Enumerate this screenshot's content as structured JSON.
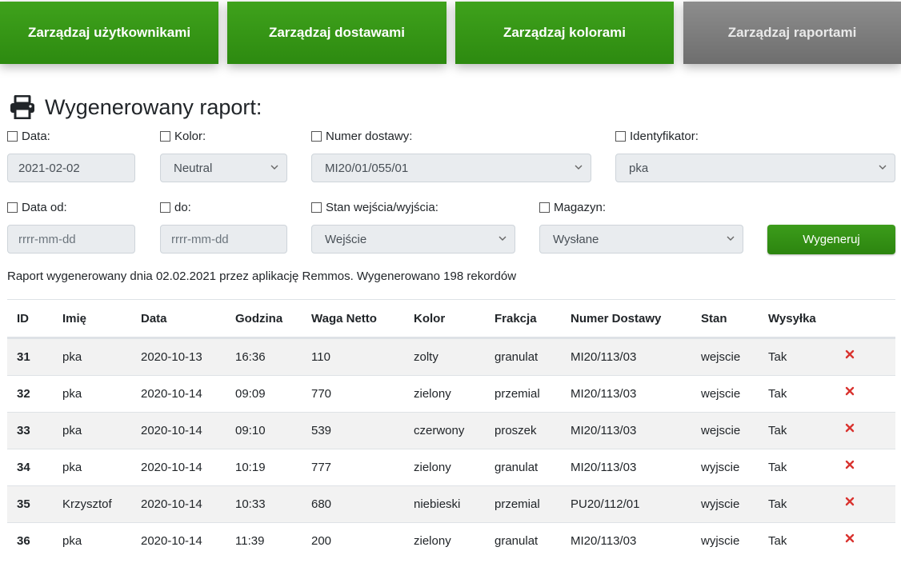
{
  "nav": {
    "users": "Zarządzaj użytkownikami",
    "deliveries": "Zarządzaj dostawami",
    "colors": "Zarządzaj kolorami",
    "reports": "Zarządzaj raportami"
  },
  "page": {
    "title": "Wygenerowany raport:",
    "title_icon": "printer-icon"
  },
  "filters": {
    "date": {
      "label": "Data:",
      "value": "2021-02-02"
    },
    "color": {
      "label": "Kolor:",
      "value": "Neutral"
    },
    "delivery_number": {
      "label": "Numer dostawy:",
      "value": "MI20/01/055/01"
    },
    "identifier": {
      "label": "Identyfikator:",
      "value": "pka"
    },
    "date_from": {
      "label": "Data od:",
      "placeholder": "rrrr-mm-dd"
    },
    "date_to": {
      "label": "do:",
      "placeholder": "rrrr-mm-dd"
    },
    "state": {
      "label": "Stan wejścia/wyjścia:",
      "value": "Wejście"
    },
    "warehouse": {
      "label": "Magazyn:",
      "value": "Wysłane"
    },
    "generate_label": "Wygeneruj"
  },
  "report_info": "Raport wygenerowany dnia 02.02.2021 przez aplikację Remmos. Wygenerowano 198 rekordów",
  "table": {
    "headers": [
      "ID",
      "Imię",
      "Data",
      "Godzina",
      "Waga Netto",
      "Kolor",
      "Frakcja",
      "Numer Dostawy",
      "Stan",
      "Wysyłka"
    ],
    "rows": [
      [
        "31",
        "pka",
        "2020-10-13",
        "16:36",
        "110",
        "zolty",
        "granulat",
        "MI20/113/03",
        "wejscie",
        "Tak"
      ],
      [
        "32",
        "pka",
        "2020-10-14",
        "09:09",
        "770",
        "zielony",
        "przemial",
        "MI20/113/03",
        "wejscie",
        "Tak"
      ],
      [
        "33",
        "pka",
        "2020-10-14",
        "09:10",
        "539",
        "czerwony",
        "proszek",
        "MI20/113/03",
        "wejscie",
        "Tak"
      ],
      [
        "34",
        "pka",
        "2020-10-14",
        "10:19",
        "777",
        "zielony",
        "granulat",
        "MI20/113/03",
        "wyjscie",
        "Tak"
      ],
      [
        "35",
        "Krzysztof",
        "2020-10-14",
        "10:33",
        "680",
        "niebieski",
        "przemial",
        "PU20/112/01",
        "wyjscie",
        "Tak"
      ],
      [
        "36",
        "pka",
        "2020-10-14",
        "11:39",
        "200",
        "zielony",
        "granulat",
        "MI20/113/03",
        "wyjscie",
        "Tak"
      ]
    ],
    "delete_icon": "close-icon"
  },
  "colors": {
    "nav_green": "#359617",
    "nav_gray": "#7d7d7d",
    "delete_red": "#d9332f",
    "stripe": "#f2f2f2"
  }
}
